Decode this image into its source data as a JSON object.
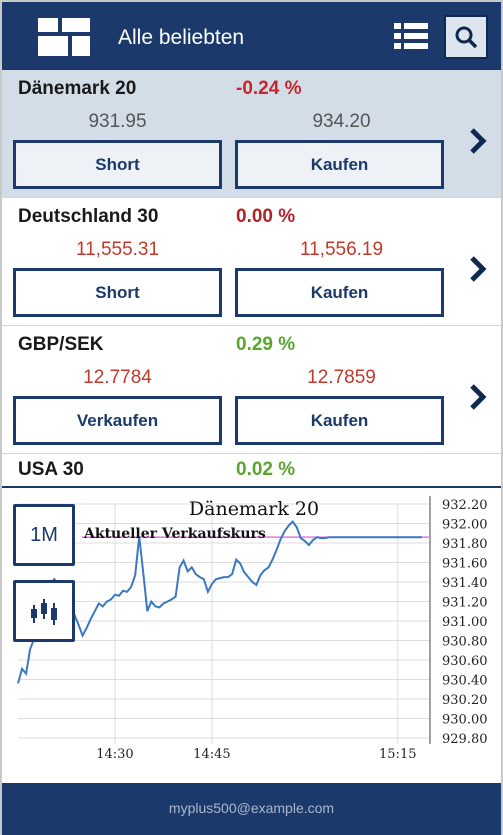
{
  "header": {
    "title": "Alle beliebten",
    "logo_icon": "grid-logo-icon",
    "list_icon": "list-view-icon",
    "search_icon": "search-icon"
  },
  "rows": [
    {
      "name": "Dänemark 20",
      "change": "-0.24 %",
      "sell_price": "931.95",
      "buy_price": "934.20",
      "sell_label": "Short",
      "buy_label": "Kaufen",
      "selected": true
    },
    {
      "name": "Deutschland 30",
      "change": "0.00 %",
      "sell_price": "11,555.31",
      "buy_price": "11,556.19",
      "sell_label": "Short",
      "buy_label": "Kaufen",
      "selected": false
    },
    {
      "name": "GBP/SEK",
      "change": "0.29 %",
      "sell_price": "12.7784",
      "buy_price": "12.7859",
      "sell_label": "Verkaufen",
      "buy_label": "Kaufen",
      "selected": false
    },
    {
      "name": "USA 30",
      "change": "0.02 %",
      "selected": false
    }
  ],
  "chart": {
    "period_label": "1M",
    "candle_icon": "candlestick-icon"
  },
  "chart_data": {
    "type": "line",
    "title": "Dänemark 20",
    "annotation": "Aktueller Verkaufskurs",
    "reference_value": 931.86,
    "y_ticks": [
      "932.20",
      "932.00",
      "931.80",
      "931.60",
      "931.40",
      "931.20",
      "931.00",
      "930.80",
      "930.60",
      "930.40",
      "930.20",
      "930.00",
      "929.80"
    ],
    "ylim": [
      929.8,
      932.2
    ],
    "x_ticks": [
      "14:30",
      "14:45",
      "15:15"
    ],
    "x": [
      0,
      1,
      2,
      3,
      4,
      5,
      6,
      7,
      8,
      9,
      10,
      11,
      12,
      13,
      14,
      15,
      16,
      17,
      18,
      19,
      20,
      21,
      22,
      23,
      24,
      25,
      26,
      27,
      28,
      29,
      30,
      31,
      32,
      33,
      34,
      35,
      36,
      37,
      38,
      39,
      40,
      41,
      42,
      43,
      44,
      45,
      46,
      47,
      48,
      49,
      50,
      51,
      52,
      53,
      54,
      55,
      56,
      57,
      58,
      59,
      60,
      61,
      62,
      63,
      64,
      65,
      66,
      67,
      68,
      69,
      70,
      71,
      72,
      73,
      74,
      75,
      76,
      77,
      78,
      79,
      80,
      81,
      82,
      83,
      84,
      85,
      86,
      87,
      88,
      89,
      90,
      91,
      92,
      93,
      94,
      95,
      96,
      97,
      98,
      99,
      100
    ],
    "values": [
      930.36,
      930.51,
      930.46,
      930.71,
      930.82,
      930.9,
      931.05,
      931.18,
      931.39,
      931.43,
      931.37,
      931.25,
      931.1,
      931.02,
      931.06,
      930.96,
      930.85,
      930.93,
      931.02,
      931.1,
      931.18,
      931.15,
      931.2,
      931.22,
      931.27,
      931.26,
      931.31,
      931.3,
      931.35,
      931.47,
      931.87,
      931.5,
      931.1,
      931.2,
      931.15,
      931.14,
      931.18,
      931.2,
      931.22,
      931.25,
      931.55,
      931.62,
      931.51,
      931.55,
      931.48,
      931.45,
      931.43,
      931.3,
      931.38,
      931.43,
      931.44,
      931.45,
      931.45,
      931.48,
      931.63,
      931.59,
      931.5,
      931.45,
      931.4,
      931.37,
      931.47,
      931.52,
      931.55,
      931.63,
      931.73,
      931.84,
      931.92,
      931.98,
      932.02,
      931.96,
      931.85,
      931.82,
      931.78,
      931.83,
      931.86,
      931.85,
      931.85,
      931.86,
      931.86,
      931.86,
      931.86,
      931.86,
      931.86,
      931.86,
      931.86,
      931.86,
      931.86,
      931.86,
      931.86,
      931.86,
      931.86,
      931.86,
      931.86,
      931.86,
      931.86,
      931.86,
      931.86,
      931.86,
      931.86,
      931.86,
      931.86
    ],
    "colors": {
      "line": "#3a78c4",
      "reference": "#e07be0",
      "grid": "#dddddd"
    }
  },
  "footer": {
    "email": "myplus500@example.com"
  }
}
